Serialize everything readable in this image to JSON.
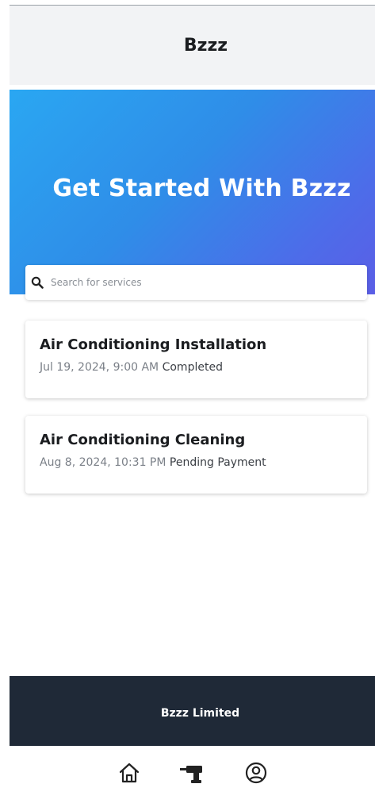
{
  "header": {
    "title": "Bzzz"
  },
  "hero": {
    "title": "Get Started With Bzzz"
  },
  "search": {
    "placeholder": "Search for services",
    "icon": "search-icon"
  },
  "services": [
    {
      "title": "Air Conditioning Installation",
      "date": "Jul 19, 2024, 9:00 AM",
      "status": "Completed"
    },
    {
      "title": "Air Conditioning Cleaning",
      "date": "Aug 8, 2024, 10:31 PM",
      "status": "Pending Payment"
    }
  ],
  "footer": {
    "text": "Bzzz Limited"
  },
  "bottom_nav": {
    "items": [
      {
        "icon": "home-icon"
      },
      {
        "icon": "drill-icon"
      },
      {
        "icon": "user-icon"
      }
    ]
  },
  "colors": {
    "hero_gradient_start": "#2aa7f2",
    "hero_gradient_end": "#5b5ee6",
    "footer_bg": "#1f2937",
    "header_bg": "#f2f3f5"
  }
}
